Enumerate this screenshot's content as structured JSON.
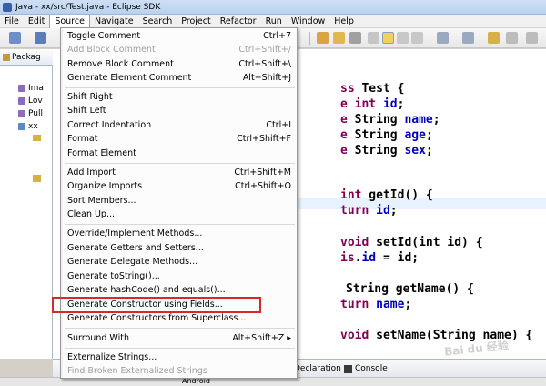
{
  "window": {
    "title": "Java - xx/src/Test.java - Eclipse SDK"
  },
  "menubar": [
    {
      "label": "File"
    },
    {
      "label": "Edit"
    },
    {
      "label": "Source",
      "active": true
    },
    {
      "label": "Navigate"
    },
    {
      "label": "Search"
    },
    {
      "label": "Project"
    },
    {
      "label": "Refactor"
    },
    {
      "label": "Run"
    },
    {
      "label": "Window"
    },
    {
      "label": "Help"
    }
  ],
  "package_explorer": {
    "tab_label": "Packag",
    "items": [
      {
        "label": "Ima"
      },
      {
        "label": "Lov"
      },
      {
        "label": "Pull"
      },
      {
        "label": "xx"
      }
    ]
  },
  "source_menu": {
    "items": [
      {
        "label": "Toggle Comment",
        "shortcut": "Ctrl+7",
        "enabled": true
      },
      {
        "label": "Add Block Comment",
        "shortcut": "Ctrl+Shift+/",
        "enabled": false
      },
      {
        "label": "Remove Block Comment",
        "shortcut": "Ctrl+Shift+\\",
        "enabled": true
      },
      {
        "label": "Generate Element Comment",
        "shortcut": "Alt+Shift+J",
        "enabled": true
      },
      {
        "label": "Shift Right",
        "shortcut": "",
        "enabled": true
      },
      {
        "label": "Shift Left",
        "shortcut": "",
        "enabled": true
      },
      {
        "label": "Correct Indentation",
        "shortcut": "Ctrl+I",
        "enabled": true
      },
      {
        "label": "Format",
        "shortcut": "Ctrl+Shift+F",
        "enabled": true
      },
      {
        "label": "Format Element",
        "shortcut": "",
        "enabled": true
      },
      {
        "label": "Add Import",
        "shortcut": "Ctrl+Shift+M",
        "enabled": true
      },
      {
        "label": "Organize Imports",
        "shortcut": "Ctrl+Shift+O",
        "enabled": true
      },
      {
        "label": "Sort Members...",
        "shortcut": "",
        "enabled": true
      },
      {
        "label": "Clean Up...",
        "shortcut": "",
        "enabled": true
      },
      {
        "label": "Override/Implement Methods...",
        "shortcut": "",
        "enabled": true
      },
      {
        "label": "Generate Getters and Setters...",
        "shortcut": "",
        "enabled": true
      },
      {
        "label": "Generate Delegate Methods...",
        "shortcut": "",
        "enabled": true
      },
      {
        "label": "Generate toString()...",
        "shortcut": "",
        "enabled": true
      },
      {
        "label": "Generate hashCode() and equals()...",
        "shortcut": "",
        "enabled": true
      },
      {
        "label": "Generate Constructor using Fields...",
        "shortcut": "",
        "enabled": true,
        "highlighted": true
      },
      {
        "label": "Generate Constructors from Superclass...",
        "shortcut": "",
        "enabled": true
      },
      {
        "label": "Surround With",
        "shortcut": "Alt+Shift+Z ▸",
        "enabled": true
      },
      {
        "label": "Externalize Strings...",
        "shortcut": "",
        "enabled": true
      },
      {
        "label": "Find Broken Externalized Strings",
        "shortcut": "",
        "enabled": false
      }
    ]
  },
  "editor": {
    "lines": [
      {
        "kw": "ss",
        "rest": " Test {"
      },
      {
        "kw": "e int",
        "fld": " id",
        "tail": ";"
      },
      {
        "kw": "e",
        "rest": " String ",
        "fld": "name",
        "tail": ";"
      },
      {
        "kw": "e",
        "rest": " String ",
        "fld": "age",
        "tail": ";"
      },
      {
        "kw": "e",
        "rest": " String ",
        "fld": "sex",
        "tail": ";"
      },
      {
        "kw": "int",
        "rest": " getId() {"
      },
      {
        "kw": "turn",
        "rest": " ",
        "fld": "id",
        "tail": ";"
      },
      {
        "kw": "void",
        "rest": " setId(int id) {"
      },
      {
        "kw": "is",
        "rest": ".",
        "fld": "id",
        "tail": " = id;"
      },
      {
        "rest": "String getName() {"
      },
      {
        "kw": "turn",
        "rest": " ",
        "fld": "name",
        "tail": ";"
      },
      {
        "kw": "void",
        "rest": " setName(String name) {"
      }
    ]
  },
  "bottom_tabs": [
    {
      "label": "Declaration"
    },
    {
      "label": "Console"
    }
  ],
  "status": {
    "text": "Android"
  },
  "watermark": {
    "text": "Bai du 经验"
  },
  "colors": {
    "keyword": "#7f0055",
    "field": "#0000c0",
    "highlight_border": "#d42a2a"
  }
}
